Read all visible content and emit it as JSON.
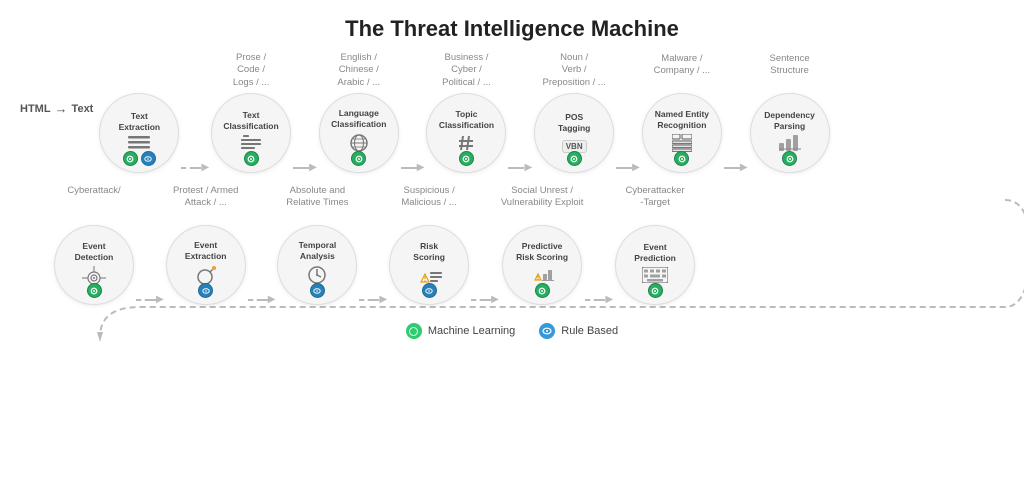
{
  "title": "The Threat Intelligence Machine",
  "row1": {
    "html_text": "HTML",
    "html_arrow": "→",
    "html_text2": "Text",
    "nodes": [
      {
        "id": "text-extraction",
        "label": "Text\nExtraction",
        "top_label": "",
        "icon": "lines",
        "badges": [
          "ml",
          "rb"
        ]
      },
      {
        "id": "text-classification",
        "label": "Text\nClassification",
        "top_label": "Prose /\nCode /\nLogs / ...",
        "icon": "text-align",
        "badges": [
          "ml"
        ]
      },
      {
        "id": "language-classification",
        "label": "Language\nClassification",
        "top_label": "English /\nChinese /\nArabic / ...",
        "icon": "globe",
        "badges": [
          "ml"
        ]
      },
      {
        "id": "topic-classification",
        "label": "Topic\nClassification",
        "top_label": "Business /\nCyber /\nPolitical / ...",
        "icon": "hash",
        "badges": [
          "ml"
        ]
      },
      {
        "id": "pos-tagging",
        "label": "POS\nTagging",
        "top_label": "Noun /\nVerb /\nPreposition / ...",
        "icon": "vbn",
        "badges": [
          "ml"
        ]
      },
      {
        "id": "named-entity",
        "label": "Named Entity\nRecognition",
        "top_label": "Malware /\nCompany / ...",
        "icon": "grid",
        "badges": [
          "ml"
        ]
      },
      {
        "id": "dependency-parsing",
        "label": "Dependency\nParsing",
        "top_label": "Sentence\nStructure",
        "icon": "chart",
        "badges": [
          "ml"
        ]
      }
    ]
  },
  "row2": {
    "nodes": [
      {
        "id": "event-detection",
        "label": "Event\nDetection",
        "top_label": "Cyberattack/",
        "icon": "radar",
        "badges": [
          "ml"
        ]
      },
      {
        "id": "event-extraction",
        "label": "Event\nExtraction",
        "top_label": "Protest / Armed\nAttack / ...",
        "icon": "bomb",
        "badges": [
          "rb"
        ]
      },
      {
        "id": "temporal-analysis",
        "label": "Temporal\nAnalysis",
        "top_label": "Absolute and\nRelative Times",
        "icon": "clock",
        "badges": [
          "rb"
        ]
      },
      {
        "id": "risk-scoring",
        "label": "Risk\nScoring",
        "top_label": "Suspicious /\nMalicious / ...",
        "icon": "warning-lines",
        "badges": [
          "rb"
        ]
      },
      {
        "id": "predictive-risk",
        "label": "Predictive\nRisk Scoring",
        "top_label": "Social Unrest /\nVulnerability Exploit",
        "icon": "warning-chart",
        "badges": [
          "ml"
        ]
      },
      {
        "id": "event-prediction",
        "label": "Event\nPrediction",
        "top_label": "Cyberattacker\n-Target",
        "icon": "keyboard",
        "badges": [
          "ml"
        ]
      }
    ]
  },
  "legend": {
    "ml_label": "Machine Learning",
    "rb_label": "Rule Based"
  }
}
